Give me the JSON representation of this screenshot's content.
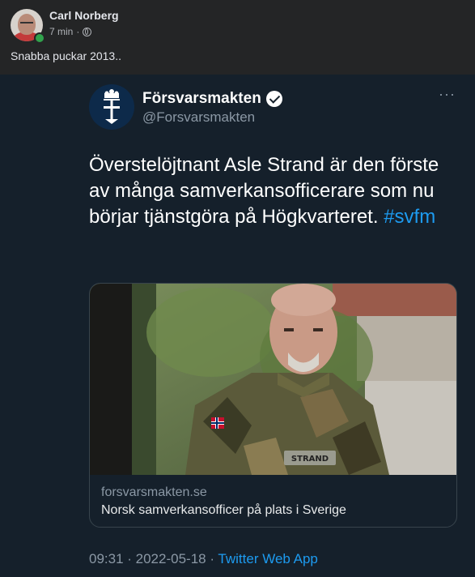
{
  "post": {
    "author": "Carl Norberg",
    "time": "7 min",
    "separator": "·",
    "text": "Snabba puckar 2013.."
  },
  "tweet": {
    "name": "Försvarsmakten",
    "handle": "@Forsvarsmakten",
    "more": "···",
    "text": "Överstelöjtnant Asle Strand är den förste av många samverkansofficerare som nu börjar tjänstgöra på Högkvarteret.",
    "hashtag": "#svfm",
    "card": {
      "domain": "forsvarsmakten.se",
      "title": "Norsk samverkansofficer på plats i Sverige",
      "name_tag": "STRAND"
    },
    "timestamp": "09:31 · 2022-05-18 · ",
    "source": "Twitter Web App"
  },
  "colors": {
    "fb_bg": "#242526",
    "twitter_bg": "#15202b",
    "twitter_blue": "#1d9bf0",
    "online": "#31a24c"
  }
}
